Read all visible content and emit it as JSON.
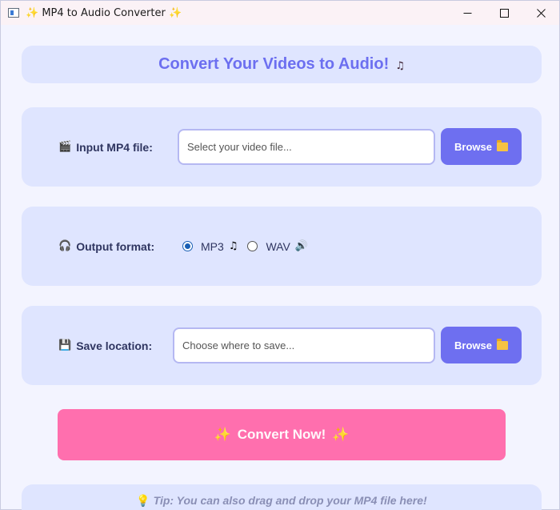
{
  "window": {
    "title": "MP4 to Audio Converter",
    "title_prefix": "✨",
    "title_suffix": "✨",
    "controls": [
      "minimize",
      "maximize",
      "close"
    ]
  },
  "header": {
    "title": "Convert Your Videos to Audio!",
    "icon": "♫"
  },
  "input_row": {
    "icon": "🎬",
    "label": "Input MP4 file:",
    "placeholder": "Select your video file...",
    "value": "",
    "browse_label": "Browse",
    "browse_icon": "folder-icon"
  },
  "format_row": {
    "icon": "🎧",
    "label": "Output format:",
    "options": [
      {
        "label": "MP3",
        "icon": "♫",
        "selected": true
      },
      {
        "label": "WAV",
        "icon": "🔊",
        "selected": false
      }
    ]
  },
  "save_row": {
    "icon": "💾",
    "label": "Save location:",
    "placeholder": "Choose where to save...",
    "value": "",
    "browse_label": "Browse",
    "browse_icon": "folder-icon"
  },
  "convert": {
    "label": "Convert Now!",
    "prefix": "✨",
    "suffix": "✨"
  },
  "tip": {
    "icon": "💡",
    "text": "Tip: You can also drag and drop your MP4 file here!"
  },
  "colors": {
    "accent": "#6e6ff0",
    "panel": "#dfe5ff",
    "background": "#f3f4ff",
    "convert": "#ff6fae",
    "radio_selected": "#1a5fb4"
  }
}
